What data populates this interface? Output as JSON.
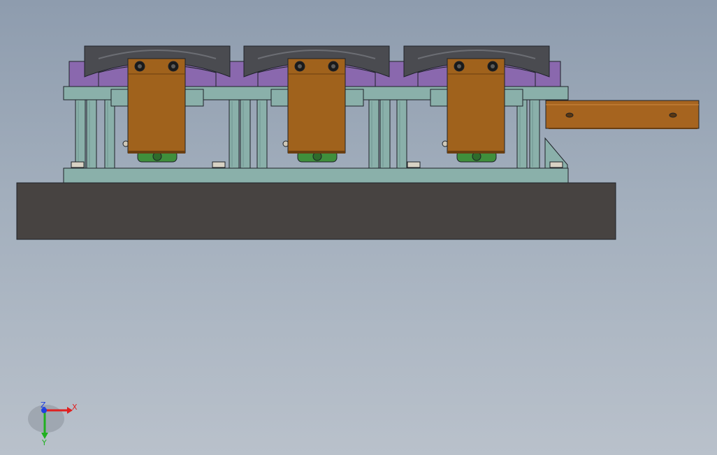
{
  "viewport": {
    "background_top": "#8e9cae",
    "background_bottom": "#b9c1cb"
  },
  "model": {
    "colors": {
      "base_plate": "#474341",
      "frame": "#8ab0aa",
      "frame_dark": "#6f9590",
      "fixture_purple": "#8a68ae",
      "clamp_block": "#a0621c",
      "roller": "#4a4b50",
      "nut_green": "#3f8f3c",
      "side_arm": "#a6641f"
    },
    "station_count": 3
  },
  "triad": {
    "x_label": "X",
    "z_label": "Z",
    "y_label": "Y",
    "x_color": "#e02020",
    "y_color": "#20b020",
    "z_color": "#2040e0"
  }
}
